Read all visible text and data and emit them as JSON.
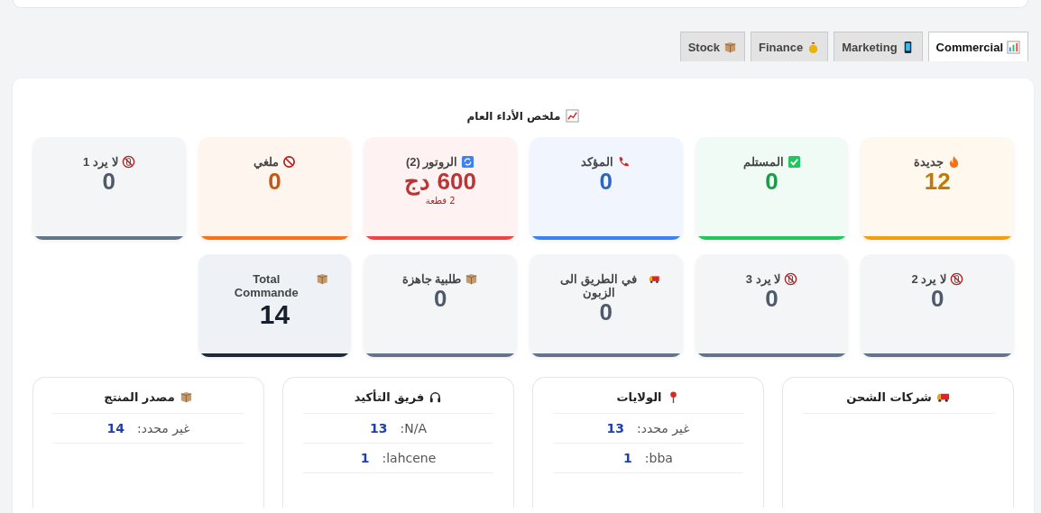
{
  "tabs": [
    {
      "label": "Commercial",
      "selected": true
    },
    {
      "label": "Marketing",
      "selected": false
    },
    {
      "label": "Finance",
      "selected": false
    },
    {
      "label": "Stock",
      "selected": false
    }
  ],
  "summary": {
    "title": "ملخص الأداء العام",
    "cards": [
      {
        "kind": "stat",
        "label": "جديدة",
        "value": "12",
        "color": "#f59e0b"
      },
      {
        "kind": "stat",
        "label": "المستلم",
        "value": "0",
        "color": "#22c55e"
      },
      {
        "kind": "stat",
        "label": "المؤكد",
        "value": "0",
        "color": "#3b82f6"
      },
      {
        "kind": "stat",
        "label": "الروتور (2)",
        "value": "600 دج",
        "sub": "2 قطعة",
        "color": "#ef4444"
      },
      {
        "kind": "stat",
        "label": "ملغي",
        "value": "0",
        "color": "#f97316"
      },
      {
        "kind": "stat",
        "label": "لا يرد 1",
        "value": "0",
        "color": "#64748b"
      },
      {
        "kind": "stat",
        "label": "لا يرد 2",
        "value": "0",
        "color": "#64748b"
      },
      {
        "kind": "stat",
        "label": "لا يرد 3",
        "value": "0",
        "color": "#64748b"
      },
      {
        "kind": "stat",
        "label": "في الطريق الى الزبون",
        "value": "0",
        "color": "#64748b"
      },
      {
        "kind": "stat",
        "label": "طلبية جاهزة",
        "value": "0",
        "color": "#64748b"
      },
      {
        "kind": "total",
        "label": "Total Commande",
        "value": "14",
        "color": "#1e293b"
      }
    ]
  },
  "panels": [
    {
      "title": "شركات الشحن"
    },
    {
      "title": "الولايات",
      "rows": [
        {
          "label": "غير محدد:",
          "value": "13"
        },
        {
          "label": "bba:",
          "value": "1"
        }
      ]
    },
    {
      "title": "فريق التأكيد",
      "rows": [
        {
          "label": "N/A:",
          "value": "13"
        },
        {
          "label": "lahcene:",
          "value": "1"
        }
      ]
    },
    {
      "title": "مصدر المنتج",
      "rows": [
        {
          "label": "غير محدد:",
          "value": "14"
        }
      ]
    }
  ]
}
